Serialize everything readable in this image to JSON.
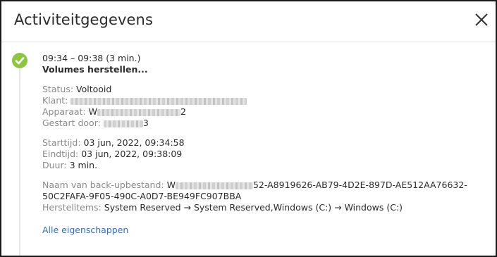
{
  "dialog": {
    "title": "Activiteitgegevens",
    "close_icon": "close-icon"
  },
  "activity": {
    "status_icon": "check-circle-icon",
    "status_color": "#8dc63f",
    "time_range": "09:34 – 09:38 (3 min.)",
    "operation": "Volumes herstellen...",
    "details": {
      "status_label": "Status:",
      "status_value": "Voltooid",
      "client_label": "Klant:",
      "device_label": "Apparaat:",
      "device_value_prefix": "W",
      "device_value_suffix": "2",
      "started_by_label": "Gestart door:",
      "started_by_suffix": "3"
    },
    "times": {
      "start_label": "Starttijd:",
      "start_value": "03 jun, 2022, 09:34:58",
      "end_label": "Eindtijd:",
      "end_value": "03 jun, 2022, 09:38:09",
      "duration_label": "Duur:",
      "duration_value": "3 min."
    },
    "backup": {
      "file_label": "Naam van back-upbestand:",
      "file_prefix": "W",
      "file_value": "52-A8919626-AB79-4D2E-897D-AE512AA76632-50C2FAFA-9F05-490C-A0D7-BE949FC907BBA",
      "items_label": "Herstelitems:",
      "items_value": "System Reserved → System Reserved,Windows (C:) → Windows (C:)"
    },
    "all_properties_link": "Alle eigenschappen"
  }
}
